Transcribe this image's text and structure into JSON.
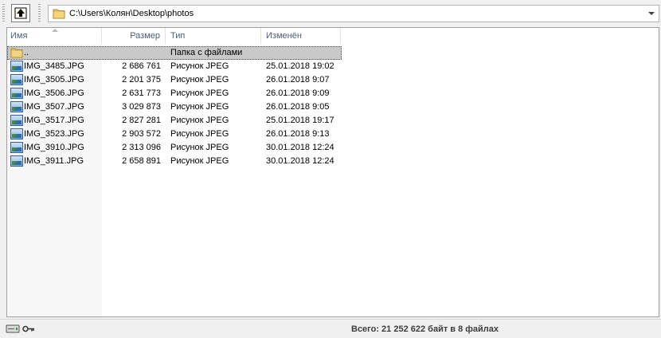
{
  "toolbar": {
    "up_icon": "up-folder-icon",
    "path": "C:\\Users\\Колян\\Desktop\\photos"
  },
  "columns": {
    "name": "Имя",
    "size": "Размер",
    "type": "Тип",
    "modified": "Изменён",
    "sort": "name-ascending"
  },
  "rows": [
    {
      "name": "..",
      "size": "",
      "type": "Папка с файлами",
      "modified": "",
      "icon": "folder-icon",
      "selected": true
    },
    {
      "name": "IMG_3485.JPG",
      "size": "2 686 761",
      "type": "Рисунок JPEG",
      "modified": "25.01.2018 19:02",
      "icon": "jpeg-image-icon"
    },
    {
      "name": "IMG_3505.JPG",
      "size": "2 201 375",
      "type": "Рисунок JPEG",
      "modified": "26.01.2018 9:07",
      "icon": "jpeg-image-icon"
    },
    {
      "name": "IMG_3506.JPG",
      "size": "2 631 773",
      "type": "Рисунок JPEG",
      "modified": "26.01.2018 9:09",
      "icon": "jpeg-image-icon"
    },
    {
      "name": "IMG_3507.JPG",
      "size": "3 029 873",
      "type": "Рисунок JPEG",
      "modified": "26.01.2018 9:05",
      "icon": "jpeg-image-icon"
    },
    {
      "name": "IMG_3517.JPG",
      "size": "2 827 281",
      "type": "Рисунок JPEG",
      "modified": "25.01.2018 19:17",
      "icon": "jpeg-image-icon"
    },
    {
      "name": "IMG_3523.JPG",
      "size": "2 903 572",
      "type": "Рисунок JPEG",
      "modified": "26.01.2018 9:13",
      "icon": "jpeg-image-icon"
    },
    {
      "name": "IMG_3910.JPG",
      "size": "2 313 096",
      "type": "Рисунок JPEG",
      "modified": "30.01.2018 12:24",
      "icon": "jpeg-image-icon"
    },
    {
      "name": "IMG_3911.JPG",
      "size": "2 658 891",
      "type": "Рисунок JPEG",
      "modified": "30.01.2018 12:24",
      "icon": "jpeg-image-icon"
    }
  ],
  "status": {
    "summary": "Всего: 21 252 622 байт в 8 файлах",
    "drive_icon": "drive-icon",
    "key_icon": "key-icon"
  }
}
